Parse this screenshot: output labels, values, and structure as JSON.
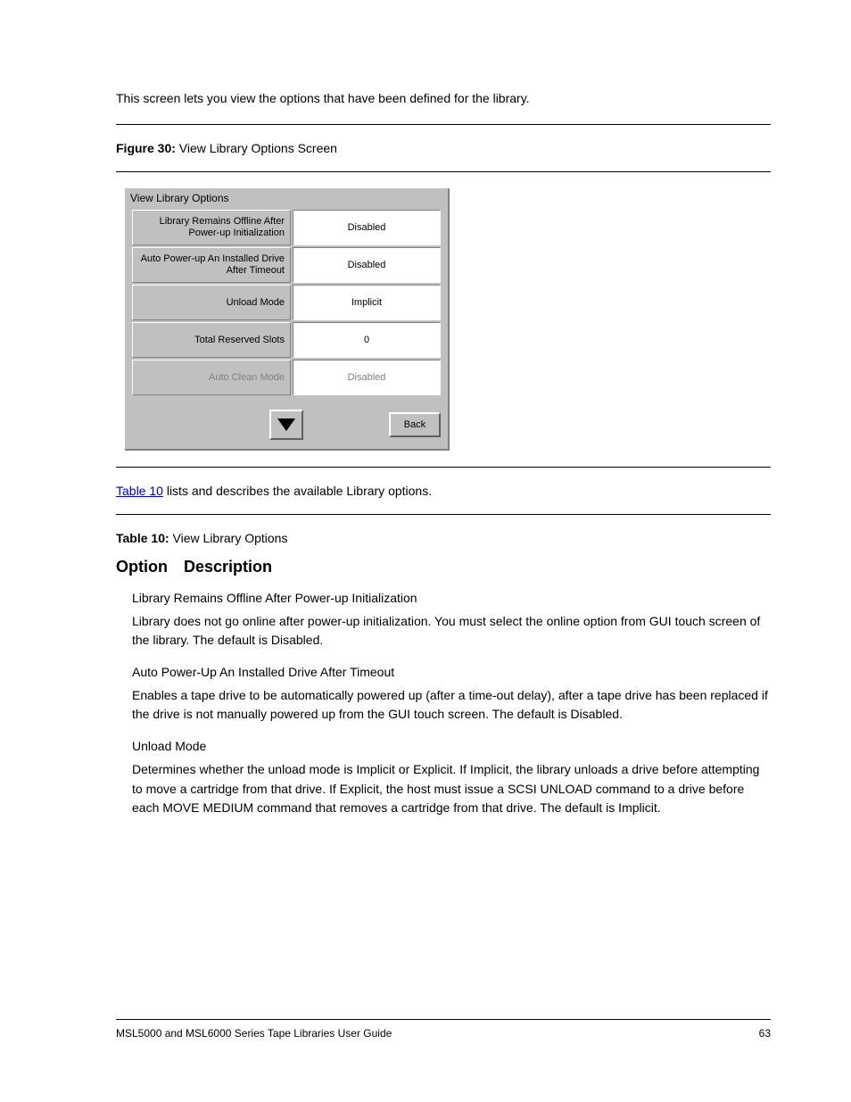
{
  "intro_text": "This screen lets you view the options that have been defined for the library.",
  "figure": {
    "prefix": "Figure 30: ",
    "title": "View Library Options Screen"
  },
  "dialog": {
    "title": "View Library Options",
    "rows": [
      {
        "label": "Library Remains Offline After Power-up Initialization",
        "value": "Disabled",
        "dim": false
      },
      {
        "label": "Auto Power-up An Installed Drive After Timeout",
        "value": "Disabled",
        "dim": false
      },
      {
        "label": "Unload Mode",
        "value": "Implicit",
        "dim": false
      },
      {
        "label": "Total Reserved Slots",
        "value": "0",
        "dim": false
      },
      {
        "label": "Auto Clean Mode",
        "value": "Disabled",
        "dim": true
      }
    ],
    "back_label": "Back"
  },
  "table_link": {
    "link_text": "Table 10",
    "after": " lists and describes the available Library options."
  },
  "table_heading": {
    "prefix": "Table 10: ",
    "title": "View Library Options"
  },
  "options": {
    "heading": "Option Description",
    "items": [
      {
        "name": "Library Remains Offline After Power-up Initialization",
        "desc": "Library does not go online after power-up initialization. You must select the online option from GUI touch screen of the library. The default is Disabled."
      },
      {
        "name": "Auto Power-Up An Installed Drive After Timeout",
        "desc": "Enables a tape drive to be automatically powered up (after a time-out delay), after a tape drive has been replaced if the drive is not manually powered up from the GUI touch screen. The default is Disabled."
      },
      {
        "name": "Unload Mode",
        "desc": "Determines whether the unload mode is Implicit or Explicit. If Implicit, the library unloads a drive before attempting to move a cartridge from that drive. If Explicit, the host must issue a SCSI UNLOAD command to a drive before each MOVE MEDIUM command that removes a cartridge from that drive. The default is Implicit."
      }
    ]
  },
  "footer": {
    "left": "MSL5000 and MSL6000 Series Tape Libraries User Guide",
    "right": "63"
  }
}
